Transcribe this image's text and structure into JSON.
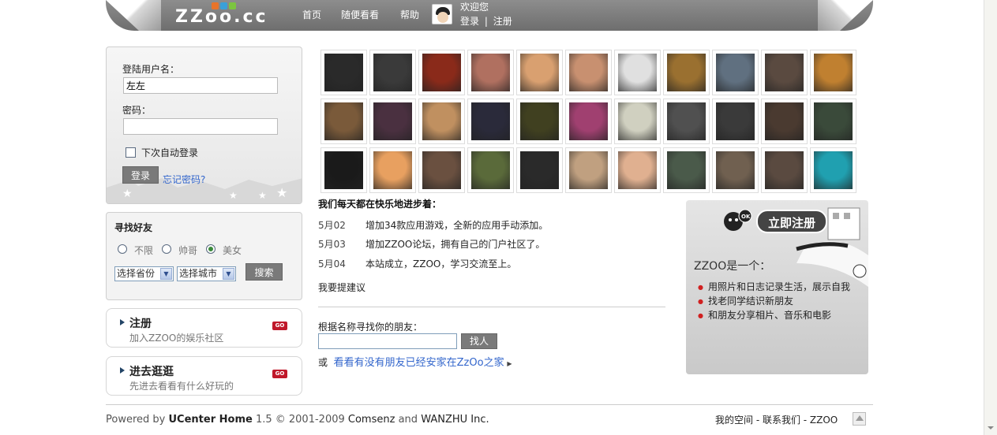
{
  "header": {
    "logo": "ZZoo.cc",
    "nav": [
      "首页",
      "随便看看",
      "帮助"
    ],
    "welcome": "欢迎您",
    "login": "登录",
    "separator": "|",
    "register": "注册"
  },
  "login_panel": {
    "username_label": "登陆用户名：",
    "username_value": "左左",
    "password_label": "密码：",
    "password_value": "",
    "remember_label": "下次自动登录",
    "login_button": "登录",
    "forgot_link": "忘记密码?"
  },
  "find_friends": {
    "title": "寻找好友",
    "options": [
      "不限",
      "帅哥",
      "美女"
    ],
    "selected": "美女",
    "province": "选择省份",
    "city": "选择城市",
    "search_button": "搜索"
  },
  "cards": [
    {
      "title": "注册",
      "sub": "加入ZZOO的娱乐社区",
      "badge": "GO"
    },
    {
      "title": "进去逛逛",
      "sub": "先进去看看有什么好玩的",
      "badge": "GO"
    }
  ],
  "news": {
    "title": "我们每天都在快乐地进步着：",
    "items": [
      {
        "date": "5月02",
        "text": "增加34款应用游戏，全新的应用手动添加。"
      },
      {
        "date": "5月03",
        "text": "增加ZZOO论坛，拥有自己的门户社区了。"
      },
      {
        "date": "5月04",
        "text": "本站成立，ZZOO，学习交流至上。"
      }
    ],
    "suggest_link": "我要提建议"
  },
  "find_by_name": {
    "label": "根据名称寻找你的朋友：",
    "button": "找人",
    "or": "或",
    "link": "看看有没有朋友已经安家在ZzOo之家"
  },
  "promo": {
    "button": "立即注册",
    "ok_badge": "OK",
    "heading": "ZZOO是一个：",
    "items": [
      "用照片和日志记录生活，展示自我",
      "找老同学结识新朋友",
      "和朋友分享相片、音乐和电影"
    ]
  },
  "footer": {
    "powered": "Powered by",
    "product": "UCenter Home",
    "rest": "1.5 © 2001-2009",
    "company1": "Comsenz",
    "and": "and",
    "company2": "WANZHU Inc.",
    "links": "我的空间 - 联系我们 - ZZOO"
  },
  "colors": {
    "header": "#7e7e7e",
    "link": "#3366cc",
    "go_badge": "#c0182a"
  },
  "photo_tones": [
    "#2a2a2a",
    "#3a3a3a",
    "#8a2a1a",
    "#b07060",
    "#d9a070",
    "#c89070",
    "#e0e0e0",
    "#9a7030",
    "#607080",
    "#5a4a40",
    "#c08030",
    "#7a5a3a",
    "#4a3040",
    "#c09060",
    "#2a2a3a",
    "#404020",
    "#a04070",
    "#d0d0c0",
    "#505050",
    "#3a3a3a",
    "#4a3a30",
    "#3a4a3a",
    "#1a1a1a",
    "#e8a060",
    "#6a5040",
    "#5a6a3a",
    "#2a2a2a",
    "#c0a080",
    "#e0b090",
    "#4a5a4a",
    "#706050",
    "#5a4a40",
    "#20a0b0"
  ]
}
